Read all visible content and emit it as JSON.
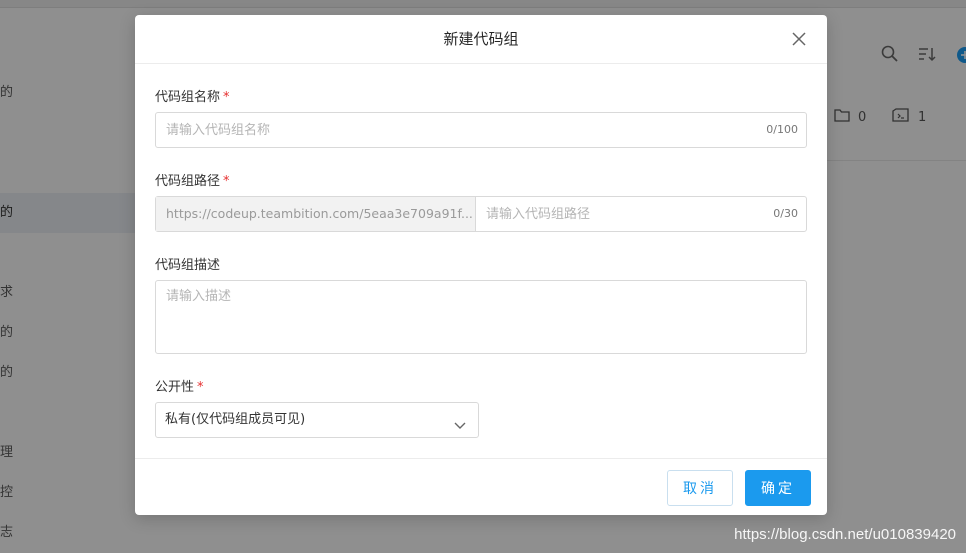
{
  "background": {
    "sidebar_items": [
      "的",
      "的",
      "求",
      "的",
      "的",
      "理",
      "控",
      "志"
    ],
    "stats": {
      "folders": "0",
      "repos": "1"
    }
  },
  "dialog": {
    "title": "新建代码组",
    "name_field": {
      "label": "代码组名称",
      "required_mark": "*",
      "placeholder": "请输入代码组名称",
      "value": "",
      "counter": "0/100"
    },
    "path_field": {
      "label": "代码组路径",
      "required_mark": "*",
      "prefix": "https://codeup.teambition.com/5eaa3e709a91f...",
      "placeholder": "请输入代码组路径",
      "value": "",
      "counter": "0/30"
    },
    "desc_field": {
      "label": "代码组描述",
      "placeholder": "请输入描述",
      "value": ""
    },
    "visibility_field": {
      "label": "公开性",
      "required_mark": "*",
      "selected": "私有(仅代码组成员可见)"
    },
    "cancel_label": "取消",
    "ok_label": "确定"
  },
  "watermark": "https://blog.csdn.net/u010839420",
  "colors": {
    "primary": "#1b9aee",
    "required": "#e62e2e"
  }
}
